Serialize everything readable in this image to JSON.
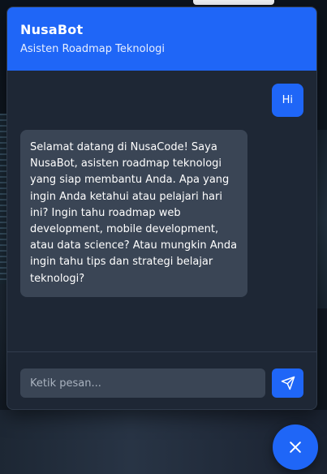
{
  "header": {
    "title": "NusaBot",
    "subtitle": "Asisten Roadmap Teknologi"
  },
  "messages": [
    {
      "sender": "user",
      "text": "Hi"
    },
    {
      "sender": "bot",
      "text": "Selamat datang di NusaCode! Saya NusaBot, asisten roadmap teknologi yang siap membantu Anda. Apa yang ingin Anda ketahui atau pelajari hari ini? Ingin tahu roadmap web development, mobile development, atau data science? Atau mungkin Anda ingin tahu tips dan strategi belajar teknologi?"
    }
  ],
  "input": {
    "placeholder": "Ketik pesan...",
    "value": ""
  },
  "icons": {
    "send": "send-icon",
    "close": "close-icon"
  },
  "colors": {
    "accent": "#1f66f7",
    "panel": "#1e2735",
    "bot_bubble": "#3a4555"
  }
}
